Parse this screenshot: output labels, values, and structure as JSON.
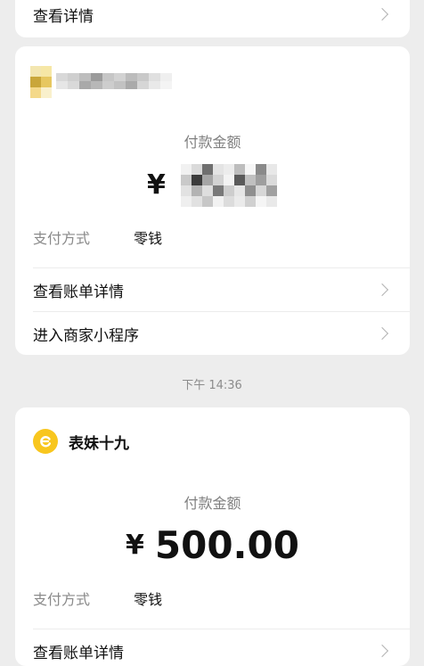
{
  "top_card": {
    "row_label": "查看详情"
  },
  "card1": {
    "merchant_name": "",
    "amount_label": "付款金额",
    "currency_symbol": "¥",
    "amount": "",
    "method_key": "支付方式",
    "method_value": "零钱",
    "rows": [
      {
        "label": "查看账单详情"
      },
      {
        "label": "进入商家小程序"
      }
    ]
  },
  "timestamp": "下午 14:36",
  "card2": {
    "merchant_name": "表妹十九",
    "amount_label": "付款金额",
    "currency_symbol": "¥",
    "amount": "500.00",
    "method_key": "支付方式",
    "method_value": "零钱",
    "rows": [
      {
        "label": "查看账单详情"
      }
    ]
  },
  "colors": {
    "background": "#ededed",
    "card": "#ffffff",
    "logo_yellow": "#f8c61e",
    "muted_text": "#7f7f7f"
  }
}
